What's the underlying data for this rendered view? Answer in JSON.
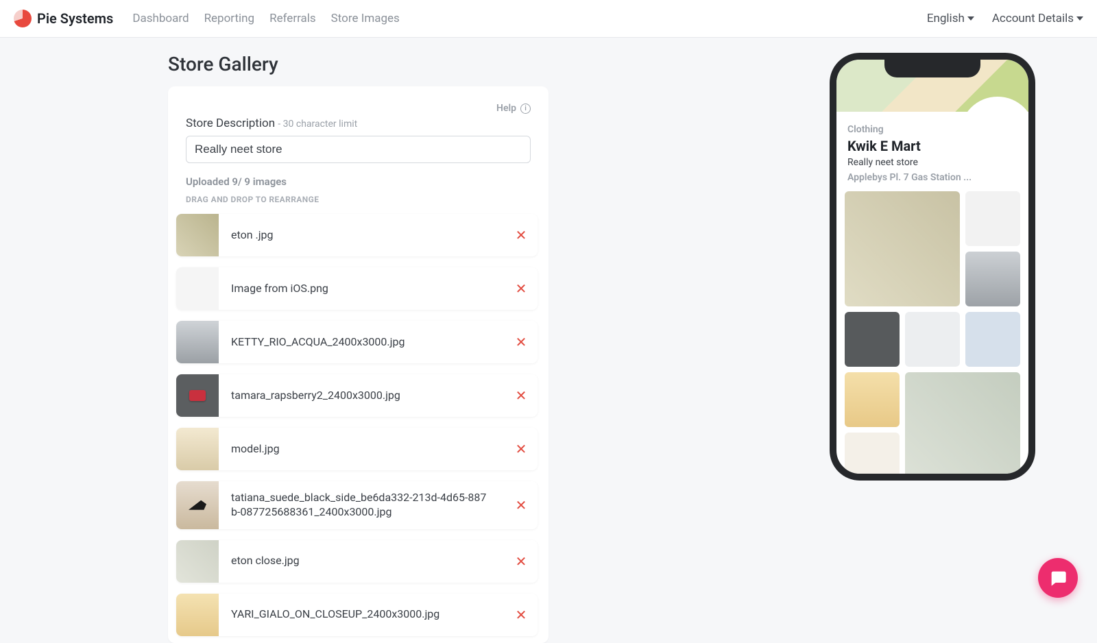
{
  "brand": "Pie Systems",
  "nav": [
    "Dashboard",
    "Reporting",
    "Referrals",
    "Store Images"
  ],
  "rightNav": {
    "language": "English",
    "account": "Account Details"
  },
  "page": {
    "title": "Store Gallery"
  },
  "help": "Help",
  "desc": {
    "label": "Store Description",
    "limit": "- 30 character limit",
    "value": "Really neet store"
  },
  "upload": {
    "count": "Uploaded 9/ 9 images",
    "hint": "DRAG AND DROP TO REARRANGE"
  },
  "files": [
    "eton .jpg",
    "Image from iOS.png",
    "KETTY_RIO_ACQUA_2400x3000.jpg",
    "tamara_rapsberry2_2400x3000.jpg",
    "model.jpg",
    "tatiana_suede_black_side_be6da332-213d-4d65-887b-087725688361_2400x3000.jpg",
    "eton close.jpg",
    "YARI_GIALO_ON_CLOSEUP_2400x3000.jpg"
  ],
  "preview": {
    "category": "Clothing",
    "store": "Kwik E Mart",
    "desc": "Really neet store",
    "address": "Applebys Pl. 7 Gas Station ..."
  }
}
